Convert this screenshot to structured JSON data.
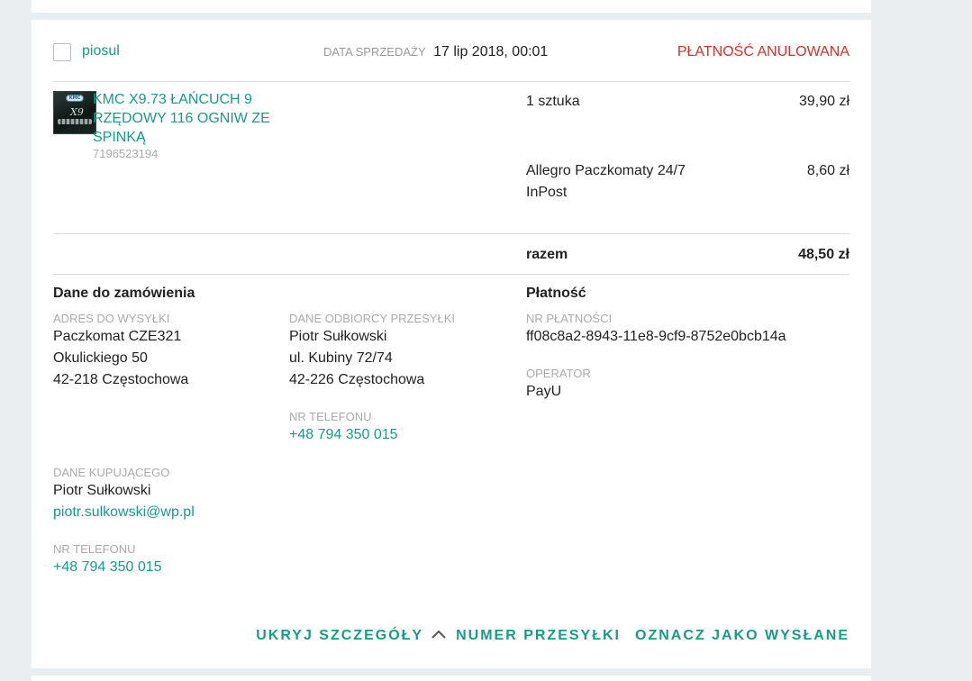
{
  "order": {
    "buyer_login": "piosul",
    "sale_date_label": "DATA SPRZEDAŻY",
    "sale_date": "17 lip 2018, 00:01",
    "status": "PŁATNOŚĆ ANULOWANA",
    "status_color": "#d4312b"
  },
  "item": {
    "thumbnail_brand": "KMC",
    "thumbnail_model": "X9",
    "title": "KMC X9.73 ŁAŃCUCH 9 RZĘDOWY 116 OGNIW ZE SPINKĄ",
    "offer_id": "7196523194",
    "quantity": "1 sztuka",
    "price": "39,90 zł"
  },
  "shipping": {
    "method": "Allegro Paczkomaty 24/7 InPost",
    "price": "8,60 zł"
  },
  "summary": {
    "total_label": "razem",
    "total": "48,50 zł"
  },
  "order_details": {
    "title": "Dane do zamówienia",
    "delivery_address": {
      "label": "ADRES DO WYSYŁKI",
      "line1": "Paczkomat CZE321",
      "line2": "Okulickiego 50",
      "line3": "42-218 Częstochowa"
    },
    "recipient": {
      "label": "DANE ODBIORCY PRZESYŁKI",
      "line1": "Piotr Sułkowski",
      "line2": "ul. Kubiny 72/74",
      "line3": "42-226 Częstochowa"
    },
    "recipient_phone": {
      "label": "NR TELEFONU",
      "value": "+48 794 350 015"
    },
    "buyer": {
      "label": "DANE KUPUJĄCEGO",
      "name": "Piotr Sułkowski",
      "email": "piotr.sulkowski@wp.pl"
    },
    "buyer_phone": {
      "label": "NR TELEFONU",
      "value": "+48 794 350 015"
    }
  },
  "payment": {
    "title": "Płatność",
    "id_label": "NR PŁATNOŚCI",
    "id": "ff08c8a2-8943-11e8-9cf9-8752e0bcb14a",
    "operator_label": "OPERATOR",
    "operator": "PayU"
  },
  "actions": {
    "hide_details": "UKRYJ SZCZEGÓŁY",
    "tracking_number": "NUMER PRZESYŁKI",
    "mark_sent": "OZNACZ JAKO WYSŁANE"
  },
  "colors": {
    "accent": "#1a9a85",
    "muted": "#aaaaaa",
    "background": "#ebeef0"
  },
  "icons": {
    "hide_details": "chevron-up-icon"
  }
}
